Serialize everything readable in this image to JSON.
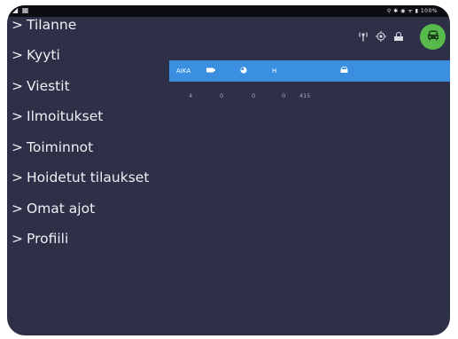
{
  "status_bar": {
    "left_icons": "◢ ▦",
    "right_text": "⚲ ✱ ◉ ᯤ ▮ 100%"
  },
  "menu": {
    "items": [
      {
        "label": "Tilanne"
      },
      {
        "label": "Kyyti"
      },
      {
        "label": "Viestit"
      },
      {
        "label": "Ilmoitukset"
      },
      {
        "label": "Toiminnot"
      },
      {
        "label": "Hoidetut tilaukset"
      },
      {
        "label": "Omat ajot"
      },
      {
        "label": "Profiili"
      }
    ],
    "chevron": ">"
  },
  "toolbar": {
    "icons": [
      "antenna-icon",
      "gps-icon",
      "shield-lock-icon"
    ],
    "car_button_icon": "car-icon",
    "car_button_color": "#58b94d"
  },
  "table": {
    "header_color": "#3a8fe0",
    "headers": [
      {
        "text": "AIKA"
      },
      {
        "text": "",
        "icon": "battery-icon"
      },
      {
        "text": "",
        "icon": "clock-icon"
      },
      {
        "text": "H"
      },
      {
        "text": "",
        "icon": "car-icon"
      }
    ],
    "row": [
      "4",
      "0",
      "0",
      "0",
      "415"
    ]
  },
  "colors": {
    "background": "#2d3046",
    "menu_text": "#eef0f5"
  }
}
